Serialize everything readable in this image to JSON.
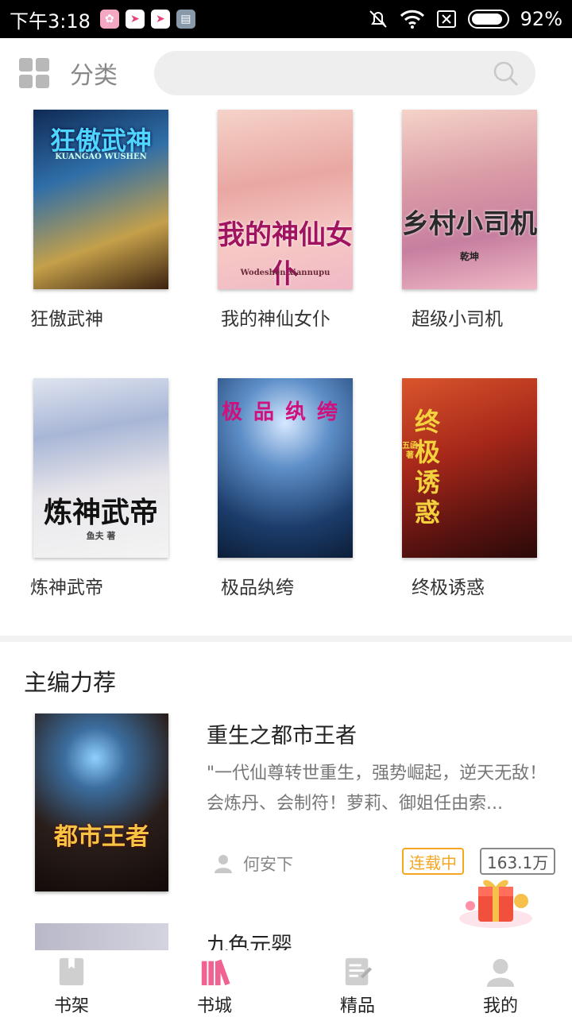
{
  "status_bar": {
    "time": "下午3:18",
    "battery": "92%",
    "battery_level": 0.92
  },
  "header": {
    "category_label": "分类",
    "search_placeholder": ""
  },
  "books": [
    {
      "title": "狂傲武神",
      "cover_text": "狂傲武神",
      "cover_sub": "KUANGAO WUSHEN"
    },
    {
      "title": "我的神仙女仆",
      "cover_text": "我的神仙女仆",
      "cover_sub": "Wodeshen xiannupu"
    },
    {
      "title": "超级小司机",
      "cover_text": "乡村小司机",
      "cover_sub": "乾坤"
    },
    {
      "title": "炼神武帝",
      "cover_text": "炼神武帝",
      "cover_sub": "鱼夫 著"
    },
    {
      "title": "极品纨绔",
      "cover_text": "极品纨绔",
      "cover_sub": ""
    },
    {
      "title": "终极诱惑",
      "cover_text": "终极诱惑",
      "cover_sub": "五函 著"
    }
  ],
  "recommend": {
    "section_title": "主编力荐",
    "items": [
      {
        "title": "重生之都市王者",
        "desc": "\"一代仙尊转世重生，强势崛起，逆天无敌！会炼丹、会制符！萝莉、御姐任由索...",
        "author": "何安下",
        "status": "连载中",
        "count": "163.1万",
        "cover_text": "都市王者"
      },
      {
        "title": "九色元婴"
      }
    ]
  },
  "nav": {
    "items": [
      {
        "label": "书架"
      },
      {
        "label": "书城"
      },
      {
        "label": "精品"
      },
      {
        "label": "我的"
      }
    ]
  },
  "colors": {
    "accent": "#f06292",
    "status_tag": "#f5a623"
  }
}
